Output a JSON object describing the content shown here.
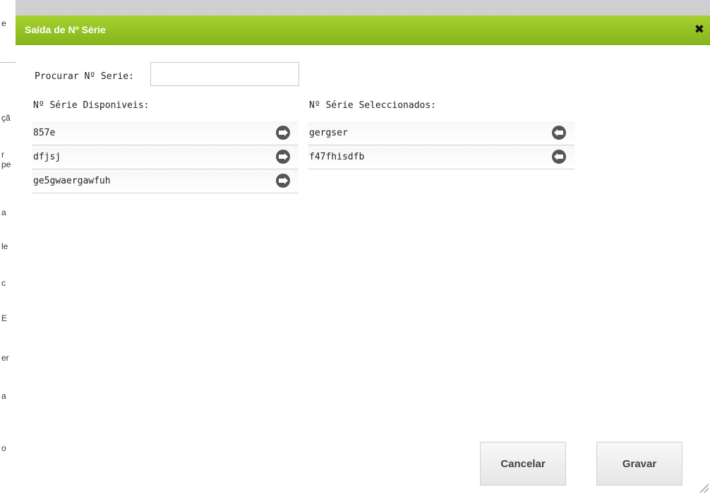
{
  "background": {
    "fragments": [
      "e",
      "çã",
      "r",
      "pe",
      "a",
      "le",
      "c",
      "E",
      "er",
      "a",
      "o"
    ]
  },
  "dialog": {
    "title": "Saída de Nº Série",
    "close_icon": "close-icon"
  },
  "search": {
    "label": "Procurar Nº Serie:",
    "value": "",
    "placeholder": ""
  },
  "available": {
    "title": "Nº Série Disponiveis:",
    "items": [
      "857e",
      "dfjsj",
      "ge5gwaergawfuh"
    ],
    "action_icon": "arrow-right-circle-icon"
  },
  "selected": {
    "title": "Nº Série Seleccionados:",
    "items": [
      "gergser",
      "f47fhisdfb"
    ],
    "action_icon": "arrow-left-circle-icon"
  },
  "buttons": {
    "cancel": "Cancelar",
    "save": "Gravar"
  },
  "colors": {
    "titlebar": "#94c425",
    "icon": "#555555"
  }
}
